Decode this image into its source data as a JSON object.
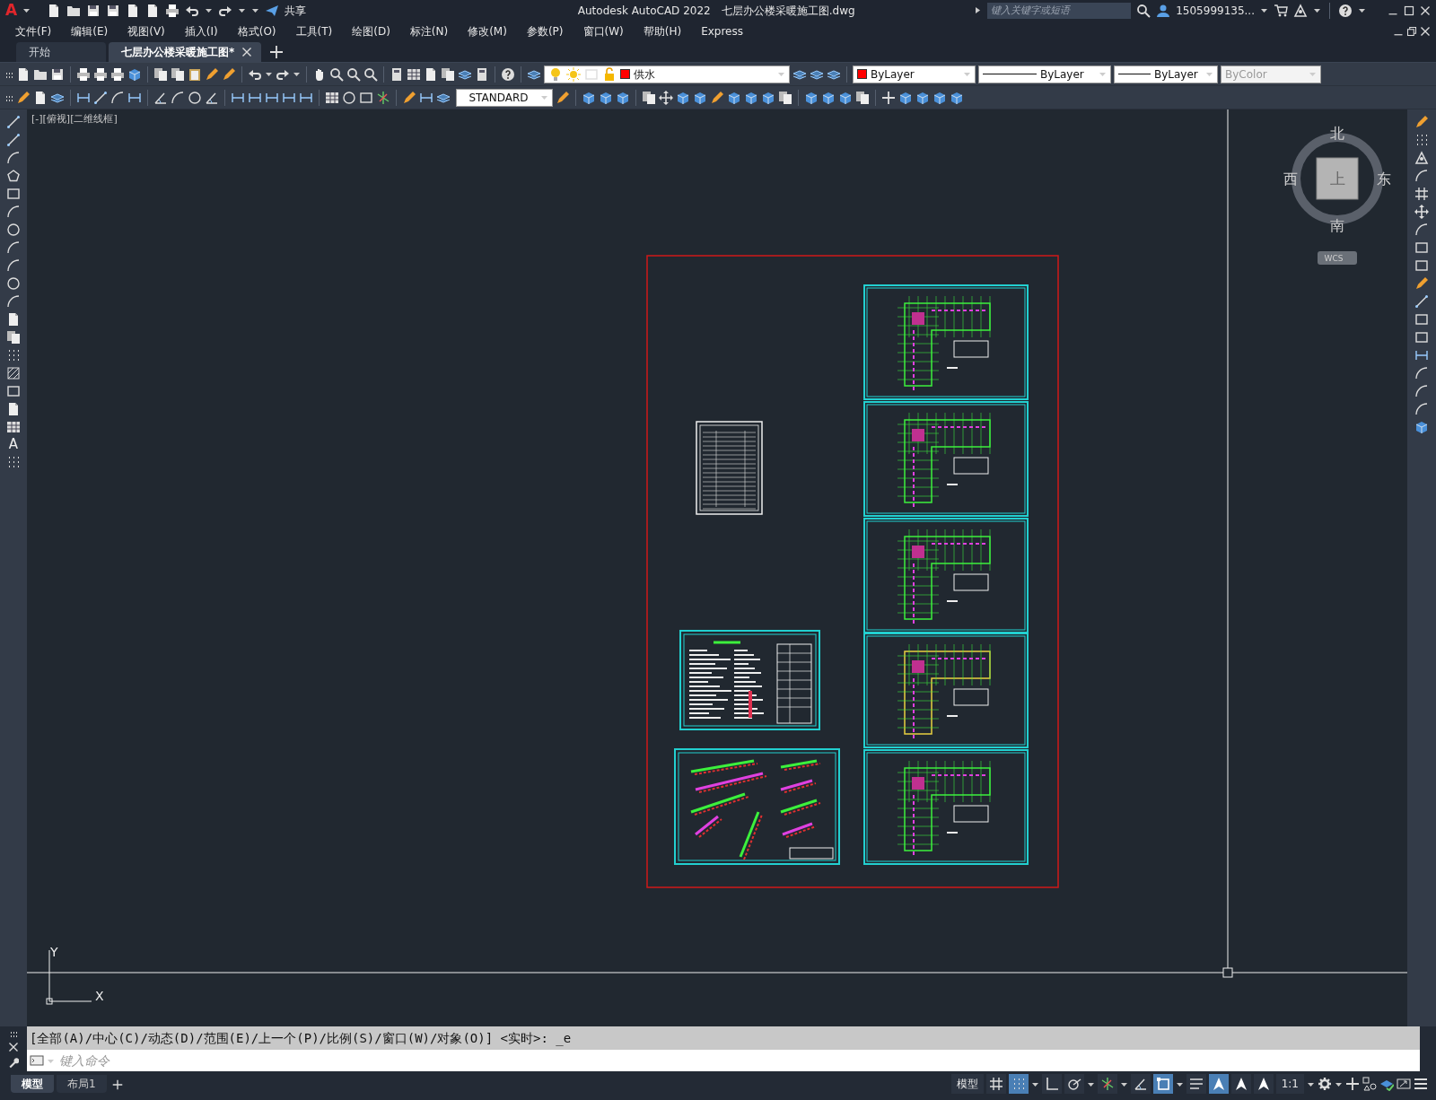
{
  "title_bar": {
    "app_logo": "A",
    "share_label": "共享",
    "title": "Autodesk AutoCAD 2022",
    "file_name": "七层办公楼采暖施工图.dwg",
    "search": {
      "placeholder": "键入关键字或短语"
    },
    "user": "1505999135..."
  },
  "menu": [
    "文件(F)",
    "编辑(E)",
    "视图(V)",
    "插入(I)",
    "格式(O)",
    "工具(T)",
    "绘图(D)",
    "标注(N)",
    "修改(M)",
    "参数(P)",
    "窗口(W)",
    "帮助(H)",
    "Express"
  ],
  "file_tabs": [
    {
      "label": "开始",
      "selected": false,
      "closable": false
    },
    {
      "label": "七层办公楼采暖施工图*",
      "selected": true,
      "closable": true
    }
  ],
  "properties": {
    "layer": {
      "value": "供水",
      "color": "#ff0000"
    },
    "color": {
      "value": "ByLayer",
      "color": "#ff0000"
    },
    "linetype": "ByLayer",
    "lineweight": "ByLayer",
    "plot_style": {
      "value": "ByColor",
      "disabled": true
    }
  },
  "text_style": "STANDARD",
  "draw_toolbar": {
    "text_tool": "A"
  },
  "viewport_label": "[-][俯视][二维线框]",
  "viewcube": {
    "north": "北",
    "south": "南",
    "west": "西",
    "east": "东",
    "face": "上",
    "ucs": "WCS"
  },
  "ucs_icon": {
    "x": "X",
    "y": "Y"
  },
  "command_line": {
    "history": "[全部(A)/中心(C)/动态(D)/范围(E)/上一个(P)/比例(S)/窗口(W)/对象(O)] <实时>: _e",
    "placeholder": "键入命令"
  },
  "layout_tabs": [
    {
      "label": "模型",
      "selected": true
    },
    {
      "label": "布局1",
      "selected": false
    }
  ],
  "status_bar": {
    "space": "模型",
    "toggles": [
      {
        "on": false
      },
      {
        "on": true
      },
      {
        "on": false
      },
      {
        "on": false
      },
      {
        "on": false
      },
      {
        "on": false
      },
      {
        "on": true
      },
      {
        "on": false
      },
      {
        "on": true
      },
      {
        "on": false
      },
      {
        "on": false
      }
    ],
    "scale": "1:1"
  }
}
